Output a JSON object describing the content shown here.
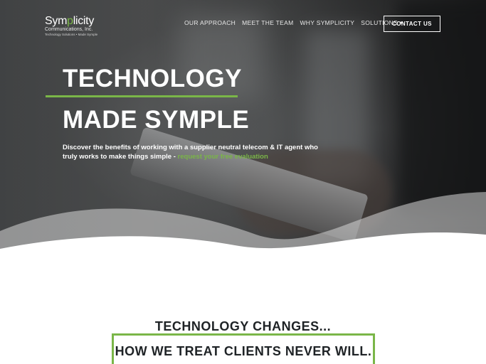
{
  "logo": {
    "brand_pre": "Sym",
    "brand_accent": "p",
    "brand_post": "licity",
    "company": "Communications, Inc.",
    "tagline": "Technology Solutions • Made Symple"
  },
  "nav": {
    "items": [
      {
        "label": "OUR APPROACH"
      },
      {
        "label": "MEET THE TEAM"
      },
      {
        "label": "WHY SYMPLICITY"
      },
      {
        "label": "SOLUTIONS",
        "has_dropdown": true
      }
    ],
    "dropdown_icon": "caret-down-icon",
    "contact_label": "CONTACT US"
  },
  "hero": {
    "headline_line1": "TECHNOLOGY",
    "headline_line2": "MADE SYMPLE",
    "subcopy": "Discover the benefits of working with a supplier neutral telecom & IT agent who truly works to make things simple - ",
    "cta_link": "request your free evaluation"
  },
  "section": {
    "title": "TECHNOLOGY CHANGES...",
    "boxed_text": "HOW WE TREAT CLIENTS NEVER WILL."
  },
  "colors": {
    "accent": "#7ab648",
    "text_dark": "#1f2326",
    "white": "#ffffff"
  }
}
